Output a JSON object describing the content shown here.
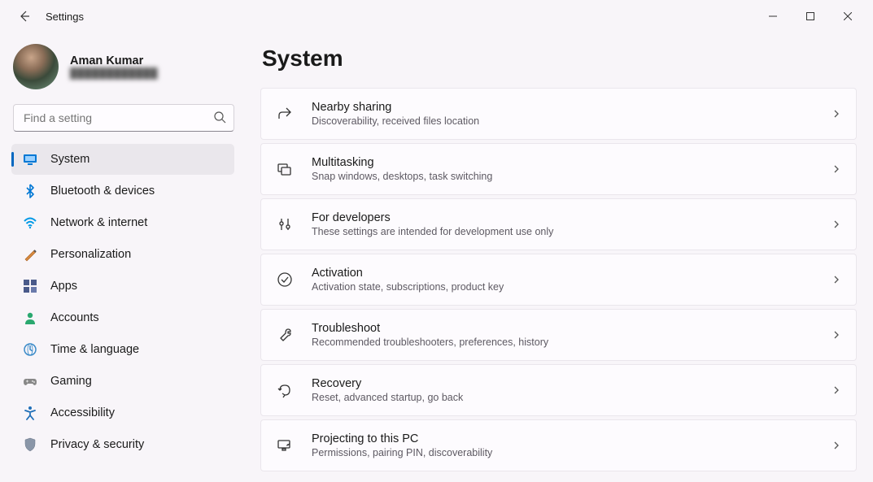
{
  "window": {
    "title": "Settings"
  },
  "profile": {
    "name": "Aman Kumar",
    "email": "████████████"
  },
  "search": {
    "placeholder": "Find a setting"
  },
  "nav": [
    {
      "id": "system",
      "label": "System",
      "active": true
    },
    {
      "id": "bluetooth",
      "label": "Bluetooth & devices"
    },
    {
      "id": "network",
      "label": "Network & internet"
    },
    {
      "id": "personalization",
      "label": "Personalization"
    },
    {
      "id": "apps",
      "label": "Apps"
    },
    {
      "id": "accounts",
      "label": "Accounts"
    },
    {
      "id": "time",
      "label": "Time & language"
    },
    {
      "id": "gaming",
      "label": "Gaming"
    },
    {
      "id": "accessibility",
      "label": "Accessibility"
    },
    {
      "id": "privacy",
      "label": "Privacy & security"
    }
  ],
  "page": {
    "heading": "System"
  },
  "cards": [
    {
      "id": "nearby",
      "title": "Nearby sharing",
      "desc": "Discoverability, received files location"
    },
    {
      "id": "multitasking",
      "title": "Multitasking",
      "desc": "Snap windows, desktops, task switching"
    },
    {
      "id": "developers",
      "title": "For developers",
      "desc": "These settings are intended for development use only"
    },
    {
      "id": "activation",
      "title": "Activation",
      "desc": "Activation state, subscriptions, product key"
    },
    {
      "id": "troubleshoot",
      "title": "Troubleshoot",
      "desc": "Recommended troubleshooters, preferences, history"
    },
    {
      "id": "recovery",
      "title": "Recovery",
      "desc": "Reset, advanced startup, go back"
    },
    {
      "id": "projecting",
      "title": "Projecting to this PC",
      "desc": "Permissions, pairing PIN, discoverability"
    }
  ]
}
